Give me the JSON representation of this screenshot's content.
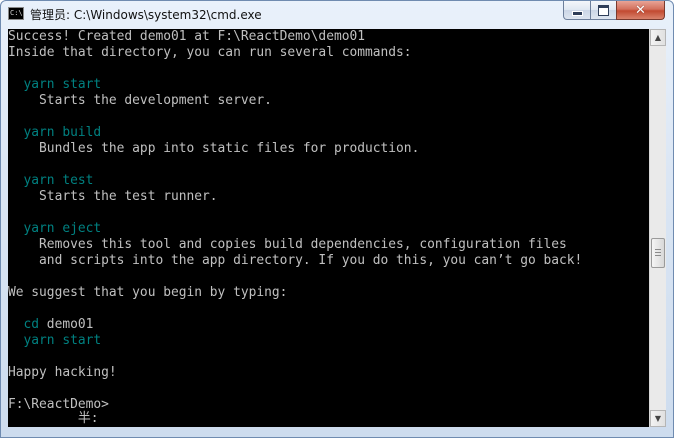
{
  "window": {
    "title": "管理员: C:\\Windows\\system32\\cmd.exe",
    "icon_label": "C:\\",
    "controls": {
      "minimize": "minimize-icon",
      "maximize": "maximize-icon",
      "close": "close-icon",
      "close_glyph": "✕"
    }
  },
  "console": {
    "lines": [
      "Success! Created demo01 at F:\\ReactDemo\\demo01",
      "Inside that directory, you can run several commands:",
      "",
      "  yarn start",
      "    Starts the development server.",
      "",
      "  yarn build",
      "    Bundles the app into static files for production.",
      "",
      "  yarn test",
      "    Starts the test runner.",
      "",
      "  yarn eject",
      "    Removes this tool and copies build dependencies, configuration files",
      "    and scripts into the app directory. If you do this, you can’t go back!",
      "",
      "We suggest that you begin by typing:",
      "",
      "  cd demo01",
      "  yarn start",
      "",
      "Happy hacking!",
      "",
      "F:\\ReactDemo>",
      "         半:"
    ],
    "text_color": "#c0c0c0",
    "accent_color": "#008080",
    "background": "#000000"
  },
  "scrollbar": {
    "up_arrow": "▲",
    "down_arrow": "▼"
  }
}
